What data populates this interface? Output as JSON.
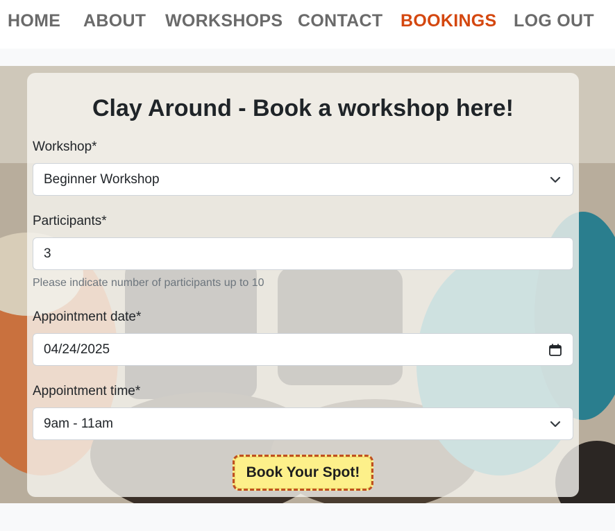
{
  "nav": {
    "items": [
      {
        "label": "HOME"
      },
      {
        "label": "ABOUT"
      },
      {
        "label": "WORKSHOPS"
      },
      {
        "label": "CONTACT"
      },
      {
        "label": "BOOKINGS",
        "active": true
      },
      {
        "label": "LOG OUT"
      }
    ]
  },
  "form": {
    "title": "Clay Around - Book a workshop here!",
    "workshop": {
      "label": "Workshop*",
      "value": "Beginner Workshop"
    },
    "participants": {
      "label": "Participants*",
      "value": "3",
      "help": "Please indicate number of participants up to 10"
    },
    "date": {
      "label": "Appointment date*",
      "value": "04/24/2025"
    },
    "time": {
      "label": "Appointment time*",
      "value": "9am - 11am"
    },
    "submit_label": "Book Your Spot!"
  },
  "colors": {
    "nav_text": "#6a6a6a",
    "nav_active": "#d4470f",
    "button_bg": "#fdf08a",
    "button_border": "#c0501f"
  },
  "icons": {
    "select": "chevron-down-icon",
    "date": "calendar-icon"
  }
}
